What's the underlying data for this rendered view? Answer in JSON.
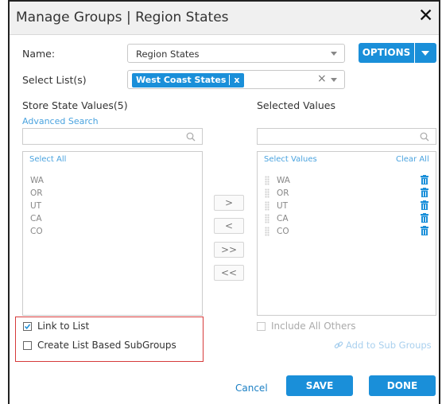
{
  "dialog": {
    "title": "Manage Groups | Region States",
    "close_label": "✕"
  },
  "form": {
    "name_label": "Name:",
    "name_value": "Region States",
    "options_label": "OPTIONS",
    "select_lists_label": "Select List(s)",
    "selected_tag": "West Coast States",
    "tag_remove": "x",
    "clear_select": "×"
  },
  "left_panel": {
    "title": "Store State Values(5)",
    "advanced_search": "Advanced Search",
    "select_all": "Select All",
    "items": [
      "WA",
      "OR",
      "UT",
      "CA",
      "CO"
    ]
  },
  "right_panel": {
    "title": "Selected Values",
    "select_values": "Select Values",
    "clear_all": "Clear All",
    "items": [
      "WA",
      "OR",
      "UT",
      "CA",
      "CO"
    ]
  },
  "move_buttons": {
    "right": ">",
    "left": "<",
    "all_right": ">>",
    "all_left": "<<"
  },
  "options": {
    "link_to_list": "Link to List",
    "link_to_list_checked": true,
    "create_subgroups": "Create List Based SubGroups",
    "create_subgroups_checked": false,
    "include_all_others": "Include All Others",
    "add_to_sub_groups": "Add to Sub Groups"
  },
  "footer": {
    "cancel": "Cancel",
    "save": "SAVE",
    "done": "DONE"
  },
  "colors": {
    "primary": "#1a8fd9",
    "link": "#4aa3df",
    "highlight_box": "#d63a3a"
  }
}
